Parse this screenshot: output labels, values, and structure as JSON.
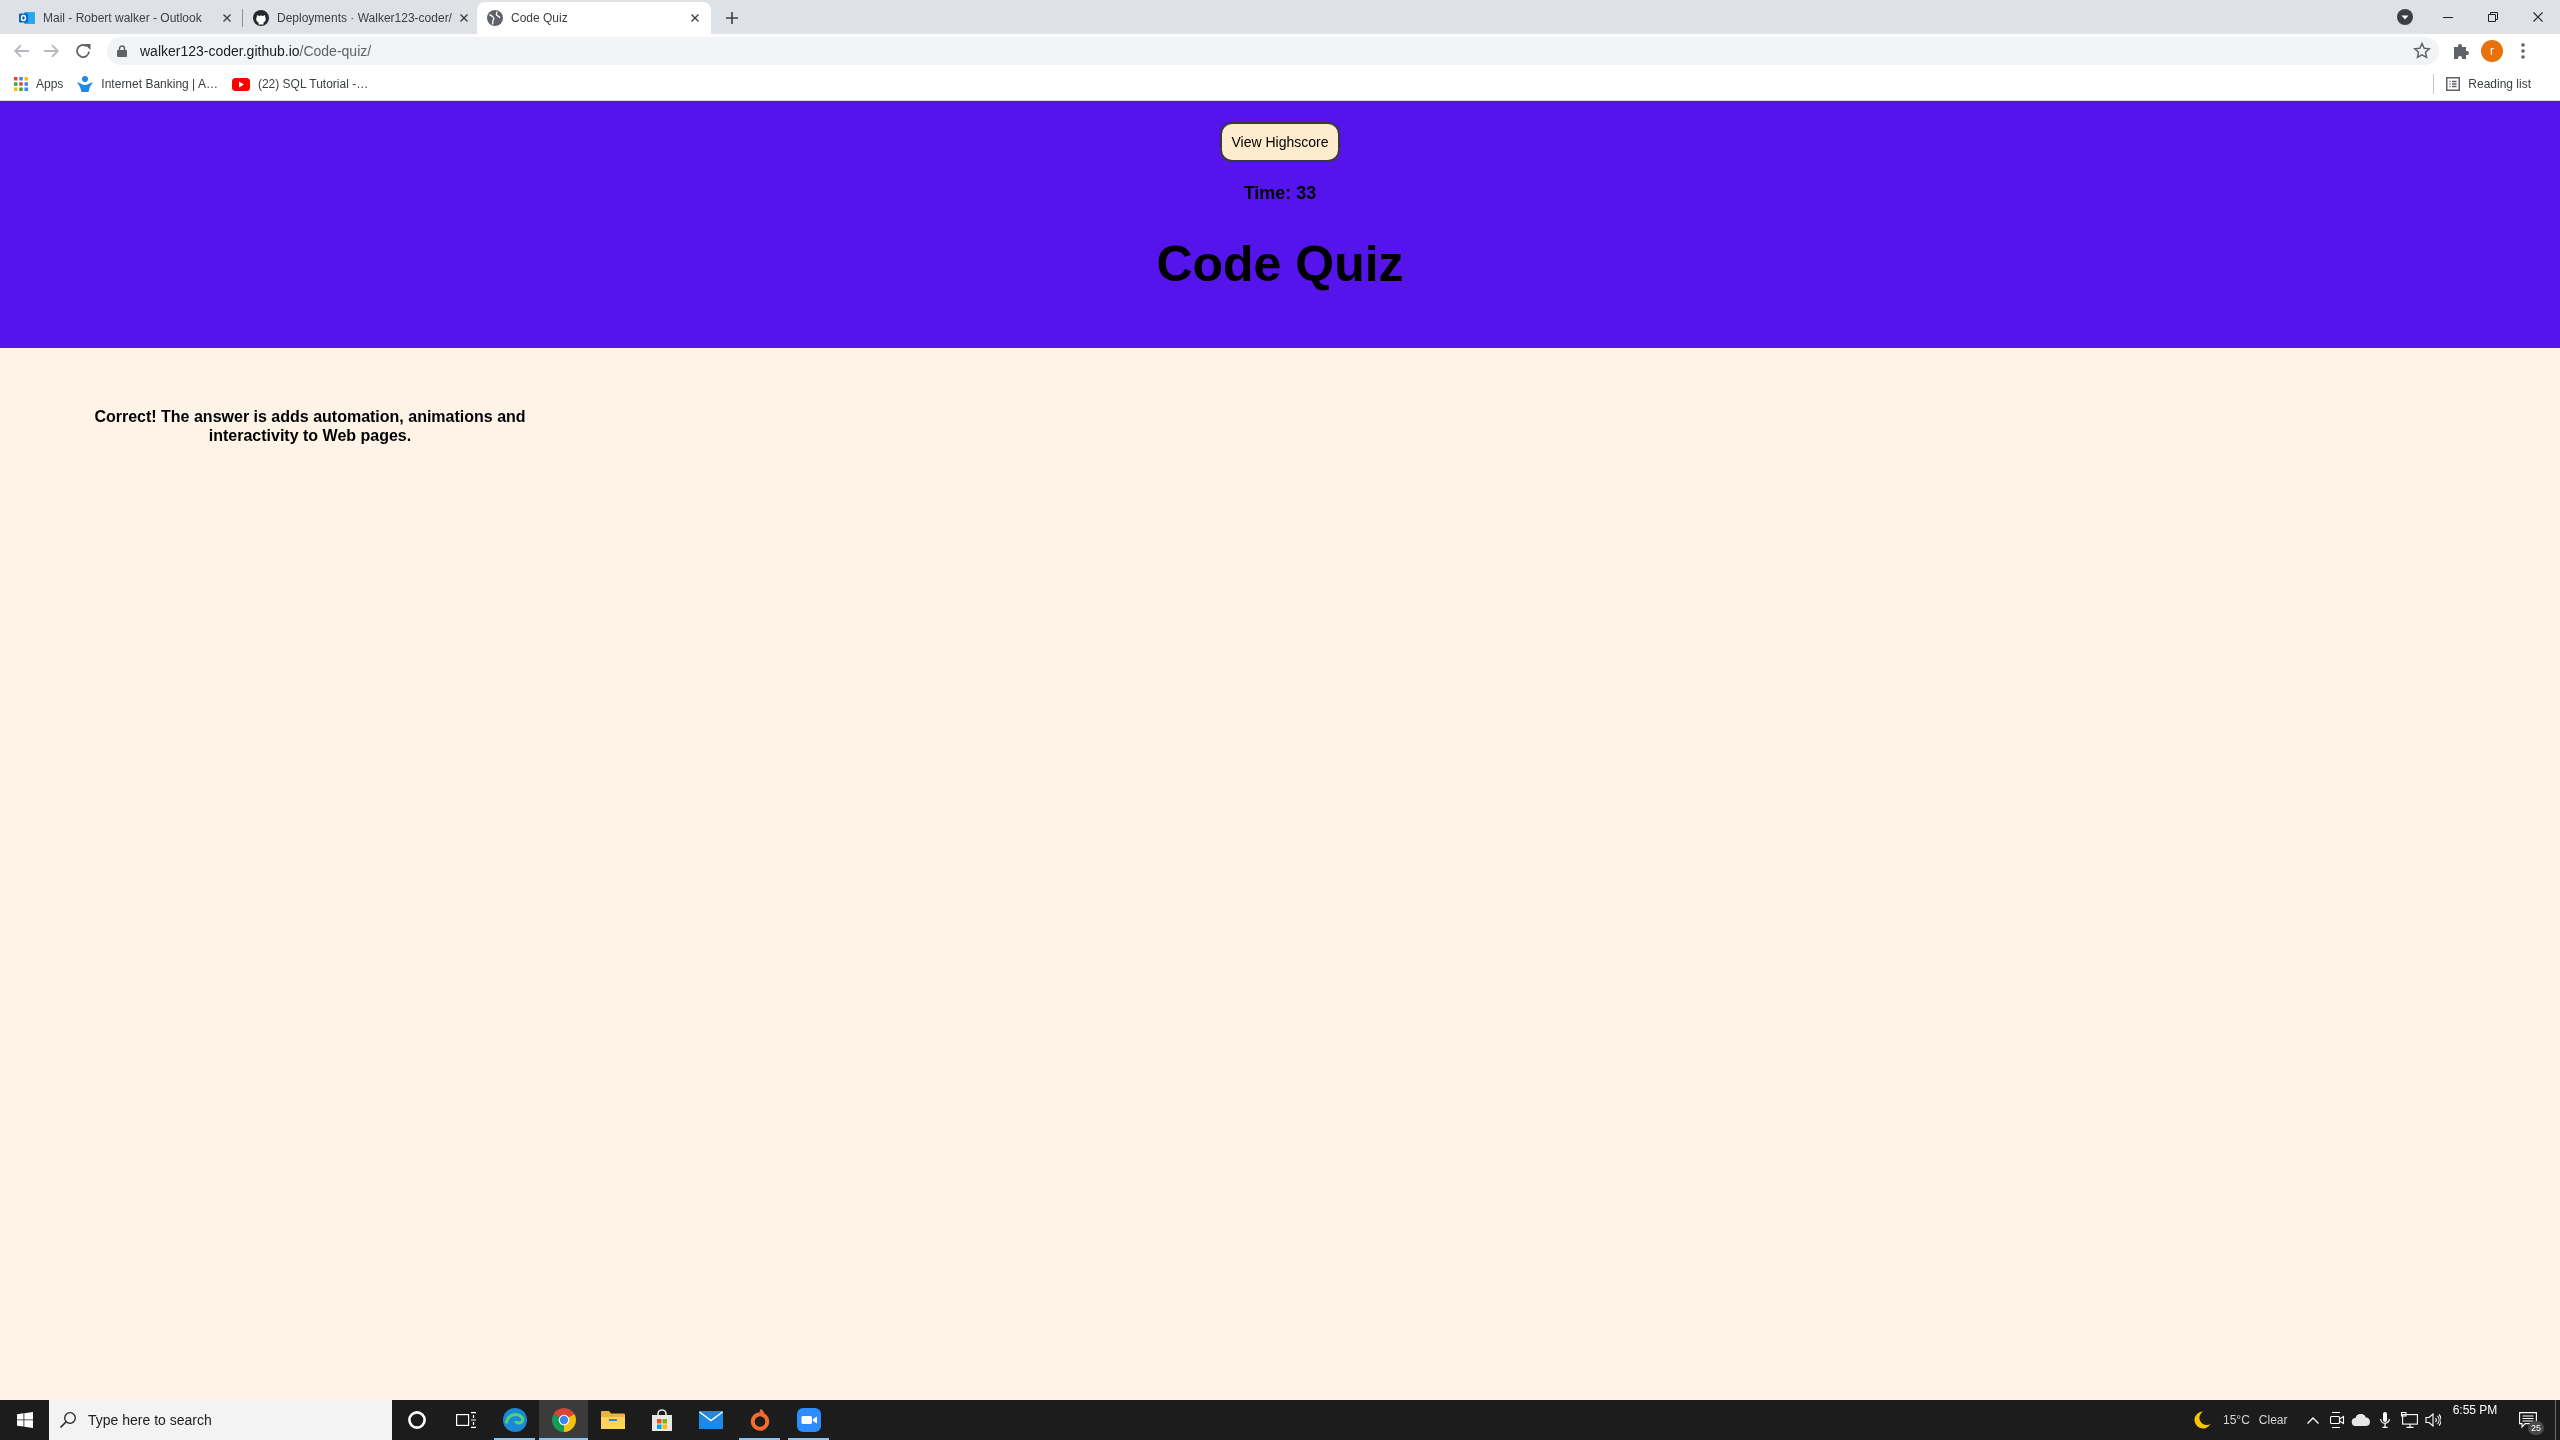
{
  "browser": {
    "tabs": [
      {
        "title": "Mail - Robert walker - Outlook",
        "kind": "mail",
        "selected": false
      },
      {
        "title": "Deployments · Walker123-coder/",
        "kind": "repo",
        "selected": false
      },
      {
        "title": "Code Quiz",
        "kind": "web",
        "selected": true
      }
    ],
    "address": {
      "host": "walker123-coder.github.io",
      "path": "/Code-quiz/"
    },
    "profile_initial": "r",
    "bookmarks": [
      {
        "label": "Apps",
        "kind": "apps"
      },
      {
        "label": "Internet Banking | A…",
        "kind": "bank"
      },
      {
        "label": "(22) SQL Tutorial -…",
        "kind": "video"
      }
    ],
    "reading_list": "Reading list"
  },
  "page": {
    "highscore_button": "View Highscore",
    "timer": "Time: 33",
    "title": "Code Quiz",
    "feedback": "Correct! The answer is adds automation, animations and interactivity to Web pages."
  },
  "taskbar": {
    "search_placeholder": "Type here to search",
    "apps": [
      {
        "kind": "edge",
        "running": true,
        "selected": false
      },
      {
        "kind": "chrome",
        "running": true,
        "selected": true
      },
      {
        "kind": "explorer",
        "running": false,
        "selected": false
      },
      {
        "kind": "store",
        "running": false,
        "selected": false
      },
      {
        "kind": "mail",
        "running": false,
        "selected": false
      },
      {
        "kind": "origin",
        "running": true,
        "selected": false
      },
      {
        "kind": "zoom",
        "running": true,
        "selected": false
      }
    ],
    "weather": {
      "temperature": "15°C",
      "condition": "Clear"
    },
    "clock": "6:55 PM",
    "notifications": "25"
  }
}
